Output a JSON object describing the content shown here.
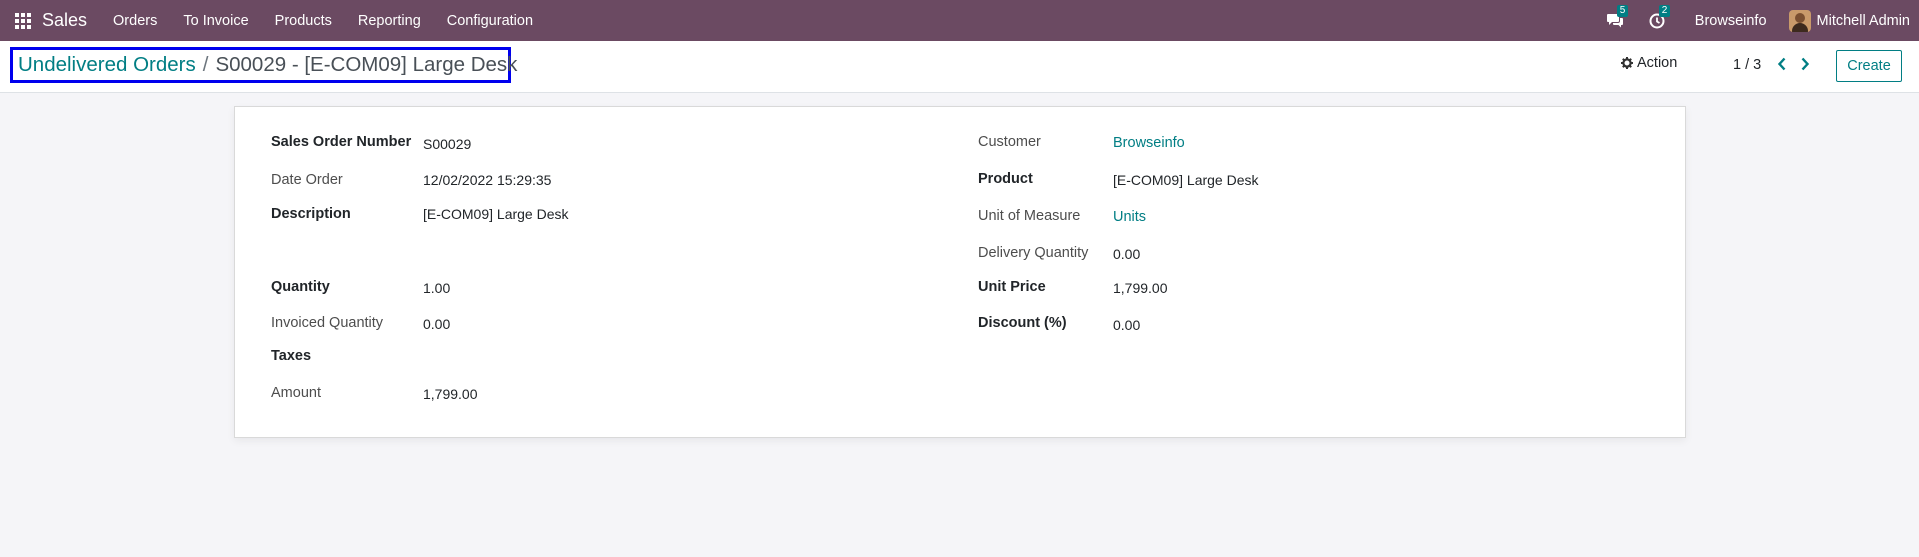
{
  "navbar": {
    "app_name": "Sales",
    "menu": [
      "Orders",
      "To Invoice",
      "Products",
      "Reporting",
      "Configuration"
    ],
    "messages_count": "5",
    "activities_count": "2",
    "company": "Browseinfo",
    "user": "Mitchell Admin",
    "accent_color": "#6b4a62",
    "badge_color": "#017e84"
  },
  "control_panel": {
    "breadcrumb_parent": "Undelivered Orders",
    "breadcrumb_separator": "/",
    "breadcrumb_current": "S00029 - [E-COM09] Large Desk",
    "action_label": "Action",
    "pager_value": "1 / 3",
    "create_label": "Create"
  },
  "form": {
    "left": {
      "order_number": {
        "label": "Sales Order Number",
        "value": "S00029"
      },
      "date_order": {
        "label": "Date Order",
        "value": "12/02/2022 15:29:35"
      },
      "description": {
        "label": "Description",
        "value": "[E-COM09] Large Desk"
      },
      "quantity": {
        "label": "Quantity",
        "value": "1.00"
      },
      "invoiced_quantity": {
        "label": "Invoiced Quantity",
        "value": "0.00"
      },
      "taxes": {
        "label": "Taxes",
        "value": ""
      },
      "amount": {
        "label": "Amount",
        "value": "1,799.00"
      }
    },
    "right": {
      "customer": {
        "label": "Customer",
        "value": "Browseinfo"
      },
      "product": {
        "label": "Product",
        "value": "[E-COM09] Large Desk"
      },
      "uom": {
        "label": "Unit of Measure",
        "value": "Units"
      },
      "delivery_quantity": {
        "label": "Delivery Quantity",
        "value": "0.00"
      },
      "unit_price": {
        "label": "Unit Price",
        "value": "1,799.00"
      },
      "discount": {
        "label": "Discount (%)",
        "value": "0.00"
      }
    }
  },
  "icons": {
    "apps": "apps-grid-icon",
    "messages": "chat-icon",
    "activities": "clock-icon",
    "action": "gear-icon",
    "pager_prev": "chevron-left-icon",
    "pager_next": "chevron-right-icon"
  }
}
